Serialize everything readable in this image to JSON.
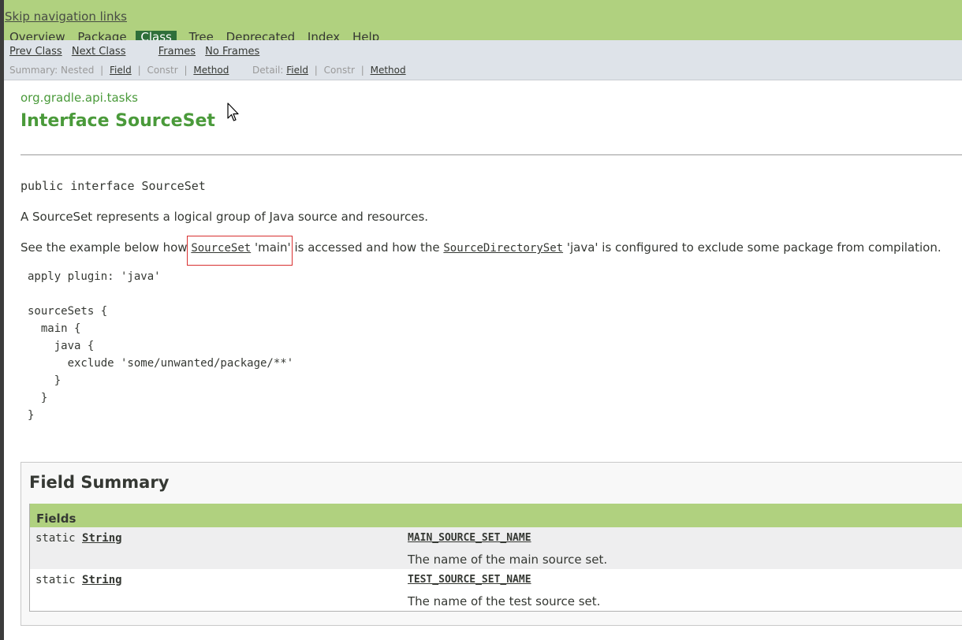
{
  "topnav": {
    "skip_link": "Skip navigation links",
    "items": [
      {
        "label": "Overview",
        "active": false
      },
      {
        "label": "Package",
        "active": false
      },
      {
        "label": "Class",
        "active": true
      },
      {
        "label": "Tree",
        "active": false
      },
      {
        "label": "Deprecated",
        "active": false
      },
      {
        "label": "Index",
        "active": false
      },
      {
        "label": "Help",
        "active": false
      }
    ]
  },
  "subnav": {
    "prev_class": "Prev Class",
    "next_class": "Next Class",
    "frames": "Frames",
    "no_frames": "No Frames",
    "summary_label": "Summary:",
    "summary_nested": "Nested",
    "summary_field": "Field",
    "summary_constr": "Constr",
    "summary_method": "Method",
    "detail_label": "Detail:",
    "detail_field": "Field",
    "detail_constr": "Constr",
    "detail_method": "Method",
    "separator": "|"
  },
  "header": {
    "package": "org.gradle.api.tasks",
    "title": "Interface SourceSet"
  },
  "content": {
    "signature": "public interface SourceSet",
    "description": "A SourceSet represents a logical group of Java source and resources.",
    "example_intro_1": "See the example below how ",
    "example_link_1": "SourceSet",
    "example_intro_2": " 'main' is accessed and how the ",
    "example_link_2": "SourceDirectorySet",
    "example_intro_3": " 'java' is configured to exclude some package from compilation.",
    "code_example": "apply plugin: 'java'\n\nsourceSets {\n  main {\n    java {\n      exclude 'some/unwanted/package/**'\n    }\n  }\n}"
  },
  "field_summary": {
    "title": "Field Summary",
    "caption": "Fields",
    "rows": [
      {
        "modifier": "static ",
        "type": "String",
        "name": "MAIN_SOURCE_SET_NAME",
        "description": "The name of the main source set."
      },
      {
        "modifier": "static ",
        "type": "String",
        "name": "TEST_SOURCE_SET_NAME",
        "description": "The name of the test source set."
      }
    ]
  },
  "colors": {
    "nav_green": "#b0d17f",
    "active_tab": "#2f6f3a",
    "subnav_gray": "#dee3e9",
    "title_green": "#4a9a3a",
    "highlight_red": "#d83030"
  }
}
